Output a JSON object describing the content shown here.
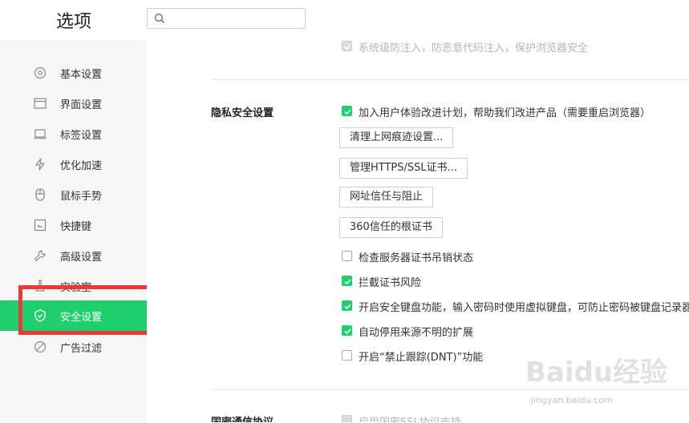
{
  "header": {
    "title": "选项",
    "search_placeholder": ""
  },
  "sidebar": {
    "items": [
      {
        "label": "基本设置",
        "icon": "gear-icon"
      },
      {
        "label": "界面设置",
        "icon": "window-icon"
      },
      {
        "label": "标签设置",
        "icon": "tab-icon"
      },
      {
        "label": "优化加速",
        "icon": "lightning-icon"
      },
      {
        "label": "鼠标手势",
        "icon": "mouse-icon"
      },
      {
        "label": "快捷键",
        "icon": "keyboard-icon"
      },
      {
        "label": "高级设置",
        "icon": "wrench-icon"
      },
      {
        "label": "实验室",
        "icon": "flask-icon"
      },
      {
        "label": "安全设置",
        "icon": "shield-icon",
        "active": true
      },
      {
        "label": "广告过滤",
        "icon": "block-icon"
      }
    ]
  },
  "main": {
    "top_row": {
      "label": "系统级防注入，防恶意代码注入，保护浏览器安全",
      "checked": true,
      "disabled": true
    },
    "privacy": {
      "title": "隐私安全设置",
      "experience": {
        "label": "加入用户体验改进计划，帮助我们改进产品（需要重启浏览器）",
        "checked": true
      },
      "buttons": [
        "清理上网痕迹设置...",
        "管理HTTPS/SSL证书...",
        "网址信任与阻止",
        "360信任的根证书"
      ],
      "options": [
        {
          "label": "检查服务器证书吊销状态",
          "checked": false
        },
        {
          "label": "拦截证书风险",
          "checked": true
        },
        {
          "label": "开启安全键盘功能，输入密码时使用虚拟键盘，可防止密码被键盘记录器",
          "checked": true
        },
        {
          "label": "自动停用来源不明的扩展",
          "checked": true
        },
        {
          "label": "开启“禁止跟踪(DNT)”功能",
          "checked": false
        }
      ]
    },
    "guomi": {
      "title": "国密通信协议",
      "option": {
        "label": "启用国密SSL协议支持",
        "checked": false,
        "disabled": true
      }
    }
  },
  "watermark": {
    "text": "Baidu经验",
    "url": "jingyan.baidu.com"
  },
  "colors": {
    "accent": "#1fce6c",
    "highlight_box": "#e83a3a",
    "sidebar_bg": "#f7f7f7"
  }
}
